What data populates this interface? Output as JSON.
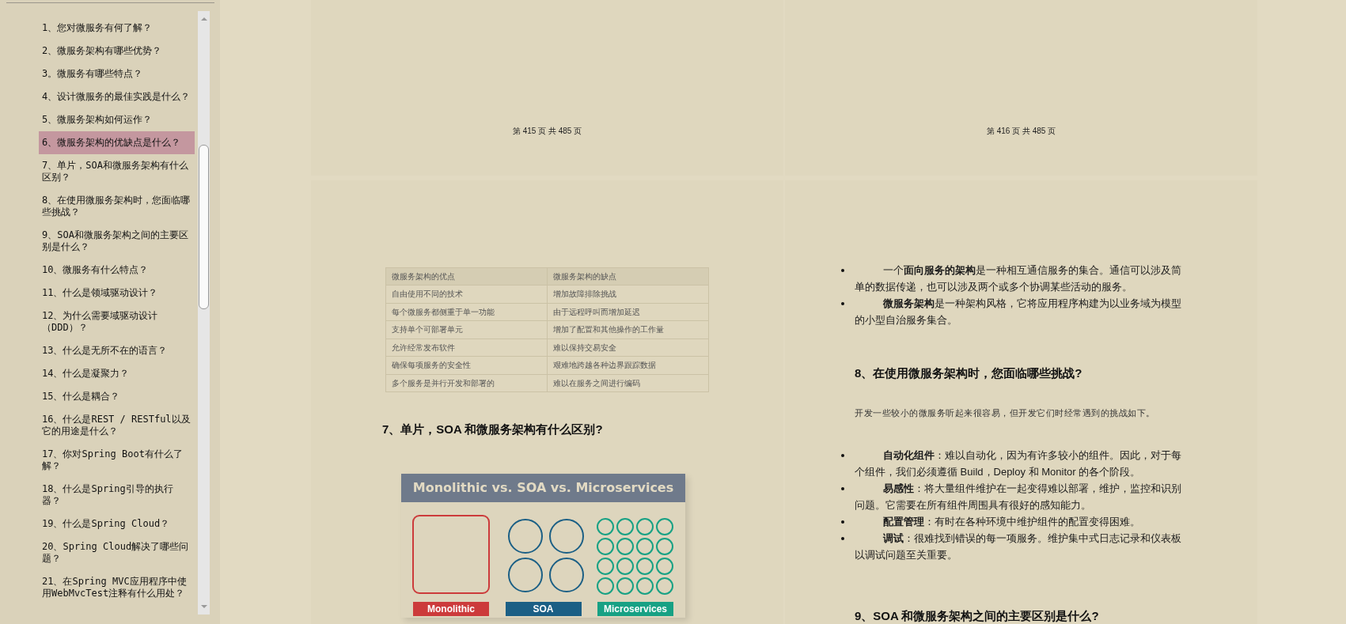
{
  "sidebar": {
    "items": [
      {
        "label": "1、您对微服务有何了解？",
        "selected": false
      },
      {
        "label": "2、微服务架构有哪些优势？",
        "selected": false
      },
      {
        "label": "3。微服务有哪些特点？",
        "selected": false
      },
      {
        "label": "4、设计微服务的最佳实践是什么？",
        "selected": false
      },
      {
        "label": "5、微服务架构如何运作？",
        "selected": false
      },
      {
        "label": "6、微服务架构的优缺点是什么？",
        "selected": true
      },
      {
        "label": "7、单片，SOA和微服务架构有什么区别？",
        "selected": false
      },
      {
        "label": "8、在使用微服务架构时，您面临哪些挑战？",
        "selected": false
      },
      {
        "label": "9、SOA和微服务架构之间的主要区别是什么？",
        "selected": false
      },
      {
        "label": "10、微服务有什么特点？",
        "selected": false
      },
      {
        "label": "11、什么是领域驱动设计？",
        "selected": false
      },
      {
        "label": "12、为什么需要域驱动设计（DDD）？",
        "selected": false
      },
      {
        "label": "13、什么是无所不在的语言？",
        "selected": false
      },
      {
        "label": "14、什么是凝聚力？",
        "selected": false
      },
      {
        "label": "15、什么是耦合？",
        "selected": false
      },
      {
        "label": "16、什么是REST / RESTful以及它的用途是什么？",
        "selected": false
      },
      {
        "label": "17、你对Spring Boot有什么了解？",
        "selected": false
      },
      {
        "label": "18、什么是Spring引导的执行器？",
        "selected": false
      },
      {
        "label": "19、什么是Spring Cloud？",
        "selected": false
      },
      {
        "label": "20、Spring Cloud解决了哪些问题？",
        "selected": false
      },
      {
        "label": "21、在Spring MVC应用程序中使用WebMvcTest注释有什么用处？",
        "selected": false
      }
    ]
  },
  "top_pages": [
    {
      "footer": "第 415 页 共 485 页"
    },
    {
      "footer": "第 416 页 共 485 页"
    }
  ],
  "left_page": {
    "table": {
      "columns": [
        "微服务架构的优点",
        "微服务架构的缺点"
      ],
      "rows": [
        [
          "自由使用不同的技术",
          "增加故障排除挑战"
        ],
        [
          "每个微服务都侧重于单一功能",
          "由于远程呼叫而增加延迟"
        ],
        [
          "支持单个可部署单元",
          "增加了配置和其他操作的工作量"
        ],
        [
          "允许经常发布软件",
          "难以保持交易安全"
        ],
        [
          "确保每项服务的安全性",
          "艰难地跨越各种边界跟踪数据"
        ],
        [
          "多个服务是并行开发和部署的",
          "难以在服务之间进行编码"
        ]
      ]
    },
    "heading": "7、单片，SOA 和微服务架构有什么区别?",
    "figure": {
      "title": "Monolithic vs. SOA vs. Microservices",
      "labels": [
        {
          "text": "Monolithic",
          "color": "#cc3b3b"
        },
        {
          "text": "SOA",
          "color": "#1b5f85"
        },
        {
          "text": "Microservices",
          "color": "#17a184"
        }
      ]
    }
  },
  "right_page": {
    "bullets": [
      "一个**面向服务的架构**是一种相互通信服务的集合。通信可以涉及简单的数据传递，也可以涉及两个或多个协调某些活动的服务。",
      "**微服务架构**是一种架构风格，它将应用程序构建为以业务域为模型的小型自治服务集合。"
    ],
    "heading": "8、在使用微服务架构时，您面临哪些挑战?",
    "intro": "开发一些较小的微服务听起来很容易，但开发它们时经常遇到的挑战如下。",
    "challenges": [
      "**自动化组件**：难以自动化，因为有许多较小的组件。因此，对于每个组件，我们必须遵循 Build，Deploy 和 Monitor 的各个阶段。",
      "**易感性**：将大量组件维护在一起变得难以部署，维护，监控和识别问题。它需要在所有组件周围具有很好的感知能力。",
      "**配置管理**：有时在各种环境中维护组件的配置变得困难。",
      "**调试**：很难找到错误的每一项服务。维护集中式日志记录和仪表板以调试问题至关重要。"
    ],
    "heading2": "9、SOA 和微服务架构之间的主要区别是什么?"
  }
}
